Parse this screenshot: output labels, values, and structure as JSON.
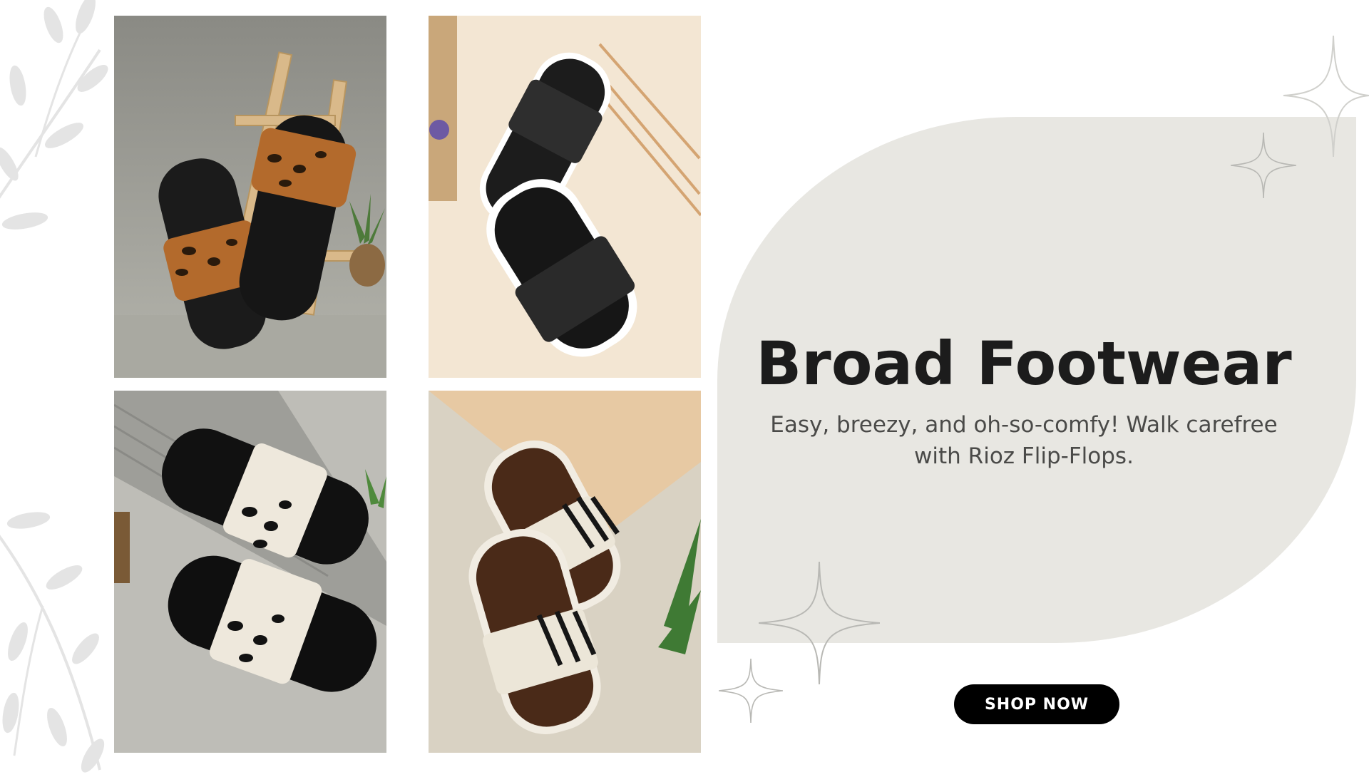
{
  "hero": {
    "headline": "Broad Footwear",
    "tagline": "Easy, breezy, and oh-so-comfy! Walk carefree with Rioz Flip-Flops.",
    "cta_label": "SHOP NOW"
  },
  "products": [
    {
      "brand": "RIOZ",
      "strap_pattern": "leopard-brown"
    },
    {
      "brand": "RIOZ",
      "strap_pattern": "black-textured"
    },
    {
      "brand": "RIOZ",
      "strap_pattern": "leopard-white"
    },
    {
      "brand": "RIOZ",
      "strap_pattern": "zebra-brown"
    }
  ],
  "icons": [
    "leaf-branch-icon",
    "sparkle-star-icon"
  ],
  "colors": {
    "panel": "#e8e7e2",
    "headline": "#1c1c1c",
    "tagline": "#4a4a48",
    "button_bg": "#000000",
    "button_text": "#ffffff"
  }
}
